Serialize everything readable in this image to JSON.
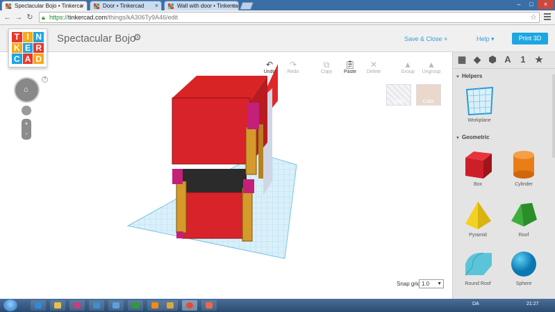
{
  "browser": {
    "tabs": [
      {
        "title": "Spectacular Bojo • Tinkerca",
        "active": true
      },
      {
        "title": "Door • Tinkercad",
        "active": false
      },
      {
        "title": "Wall with door • Tinkercad",
        "active": false
      }
    ],
    "url_scheme": "https://",
    "url_host": "tinkercad.com",
    "url_path": "/things/kA306Ty9A46/edit"
  },
  "app": {
    "logo_letters": [
      "T",
      "I",
      "N",
      "K",
      "E",
      "R",
      "C",
      "A",
      "D"
    ],
    "logo_colors": [
      "#e8362d",
      "#f7a81b",
      "#1ea6e0",
      "#f7a81b",
      "#1ea6e0",
      "#e8362d",
      "#1ea6e0",
      "#e8362d",
      "#f7a81b"
    ],
    "design_title": "Spectacular Bojo",
    "save_close": "Save & Close ×",
    "help": "Help ▾",
    "print3d": "Print 3D",
    "accent_color": "#1ea6e0"
  },
  "toolbar": {
    "undo": "Undo",
    "redo": "Redo",
    "copy": "Copy",
    "paste": "Paste",
    "delete": "Delete",
    "group": "Group",
    "ungroup": "Ungroup",
    "hole": "Hole",
    "color": "Color"
  },
  "view_controls": {
    "help": "?",
    "zoom_in": "+",
    "zoom_out": "-"
  },
  "snap": {
    "label": "Snap grid",
    "value": "1.0"
  },
  "panel": {
    "tab_a": "A",
    "tab_1": "1",
    "tab_star": "★",
    "helpers_title": "Helpers",
    "workplane": "Workplane",
    "geometric_title": "Geometric",
    "shapes": [
      "Box",
      "Cylinder",
      "Pyramid",
      "Roof",
      "Round Roof",
      "Sphere"
    ]
  },
  "taskbar": {
    "lang": "DA",
    "time": "21:27"
  }
}
